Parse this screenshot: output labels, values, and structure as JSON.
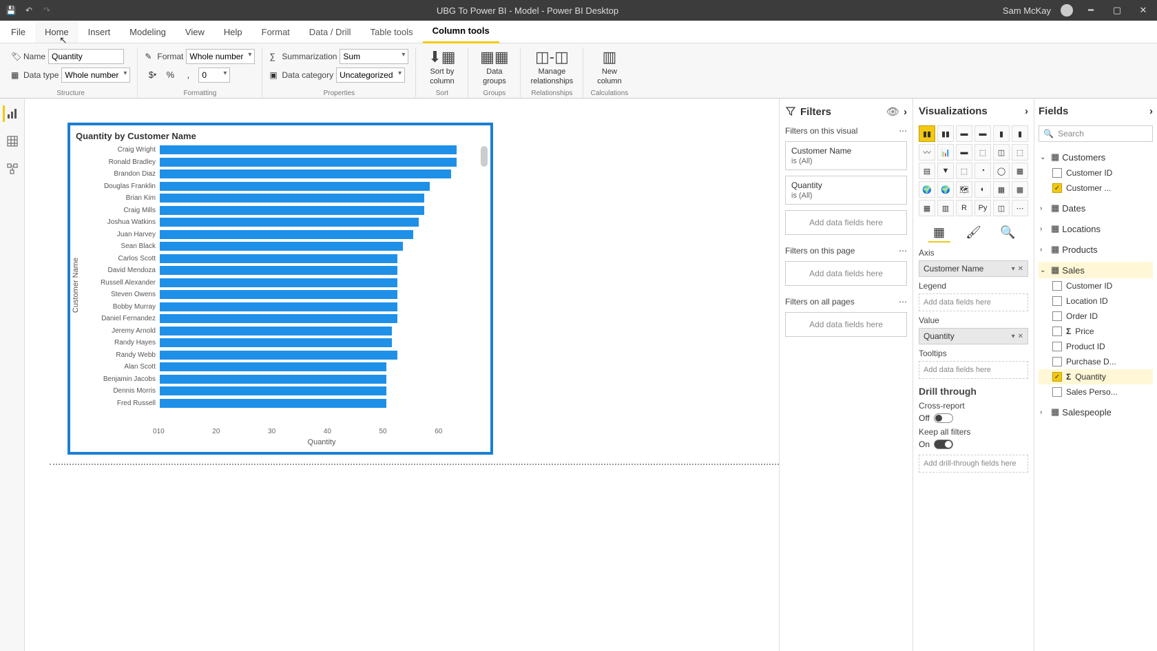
{
  "titlebar": {
    "title": "UBG To Power BI - Model - Power BI Desktop",
    "user": "Sam McKay"
  },
  "menu": {
    "items": [
      "File",
      "Home",
      "Insert",
      "Modeling",
      "View",
      "Help",
      "Format",
      "Data / Drill",
      "Table tools",
      "Column tools"
    ],
    "active": "Column tools",
    "hover": "Home"
  },
  "ribbon": {
    "name_label": "Name",
    "name_value": "Quantity",
    "datatype_label": "Data type",
    "datatype_value": "Whole number",
    "format_label": "Format",
    "format_value": "Whole number",
    "decimals": "0",
    "summarization_label": "Summarization",
    "summarization_value": "Sum",
    "datacategory_label": "Data category",
    "datacategory_value": "Uncategorized",
    "sortby": "Sort by\ncolumn",
    "datagroups": "Data\ngroups",
    "managerel": "Manage\nrelationships",
    "newcol": "New\ncolumn",
    "groups": {
      "structure": "Structure",
      "formatting": "Formatting",
      "properties": "Properties",
      "sort": "Sort",
      "grp": "Groups",
      "rel": "Relationships",
      "calc": "Calculations"
    }
  },
  "chart_data": {
    "type": "bar",
    "title": "Quantity by Customer Name",
    "xlabel": "Quantity",
    "ylabel": "Customer Name",
    "xlim": [
      0,
      60
    ],
    "xticks": [
      0,
      10,
      20,
      30,
      40,
      50,
      60
    ],
    "categories": [
      "Craig Wright",
      "Ronald Bradley",
      "Brandon Diaz",
      "Douglas Franklin",
      "Brian Kim",
      "Craig Mills",
      "Joshua Watkins",
      "Juan Harvey",
      "Sean Black",
      "Carlos Scott",
      "David Mendoza",
      "Russell Alexander",
      "Steven Owens",
      "Bobby Murray",
      "Daniel Fernandez",
      "Jeremy Arnold",
      "Randy Hayes",
      "Randy Webb",
      "Alan Scott",
      "Benjamin Jacobs",
      "Dennis Morris",
      "Fred Russell"
    ],
    "values": [
      55,
      55,
      54,
      50,
      49,
      49,
      48,
      47,
      45,
      44,
      44,
      44,
      44,
      44,
      44,
      43,
      43,
      44,
      42,
      42,
      42,
      42
    ]
  },
  "filters": {
    "title": "Filters",
    "on_visual": "Filters on this visual",
    "on_page": "Filters on this page",
    "on_all": "Filters on all pages",
    "add_here": "Add data fields here",
    "cards": [
      {
        "name": "Customer Name",
        "val": "is (All)"
      },
      {
        "name": "Quantity",
        "val": "is (All)"
      }
    ]
  },
  "viz": {
    "title": "Visualizations",
    "axis": "Axis",
    "axis_field": "Customer Name",
    "legend": "Legend",
    "value": "Value",
    "value_field": "Quantity",
    "tooltips": "Tooltips",
    "add_here": "Add data fields here",
    "drill": "Drill through",
    "cross": "Cross-report",
    "cross_state": "Off",
    "keep": "Keep all filters",
    "keep_state": "On",
    "drill_drop": "Add drill-through fields here"
  },
  "fields": {
    "title": "Fields",
    "search": "Search",
    "tables": [
      {
        "name": "Customers",
        "expanded": true,
        "items": [
          {
            "name": "Customer ID",
            "checked": false
          },
          {
            "name": "Customer ...",
            "checked": true
          }
        ]
      },
      {
        "name": "Dates",
        "expanded": false,
        "items": []
      },
      {
        "name": "Locations",
        "expanded": false,
        "items": []
      },
      {
        "name": "Products",
        "expanded": false,
        "items": []
      },
      {
        "name": "Sales",
        "expanded": true,
        "highlighted": true,
        "items": [
          {
            "name": "Customer ID",
            "checked": false
          },
          {
            "name": "Location ID",
            "checked": false
          },
          {
            "name": "Order ID",
            "checked": false
          },
          {
            "name": "Price",
            "checked": false,
            "sigma": true
          },
          {
            "name": "Product ID",
            "checked": false
          },
          {
            "name": "Purchase D...",
            "checked": false
          },
          {
            "name": "Quantity",
            "checked": true,
            "sigma": true,
            "selected": true
          },
          {
            "name": "Sales Perso...",
            "checked": false
          }
        ]
      },
      {
        "name": "Salespeople",
        "expanded": false,
        "items": []
      }
    ]
  }
}
